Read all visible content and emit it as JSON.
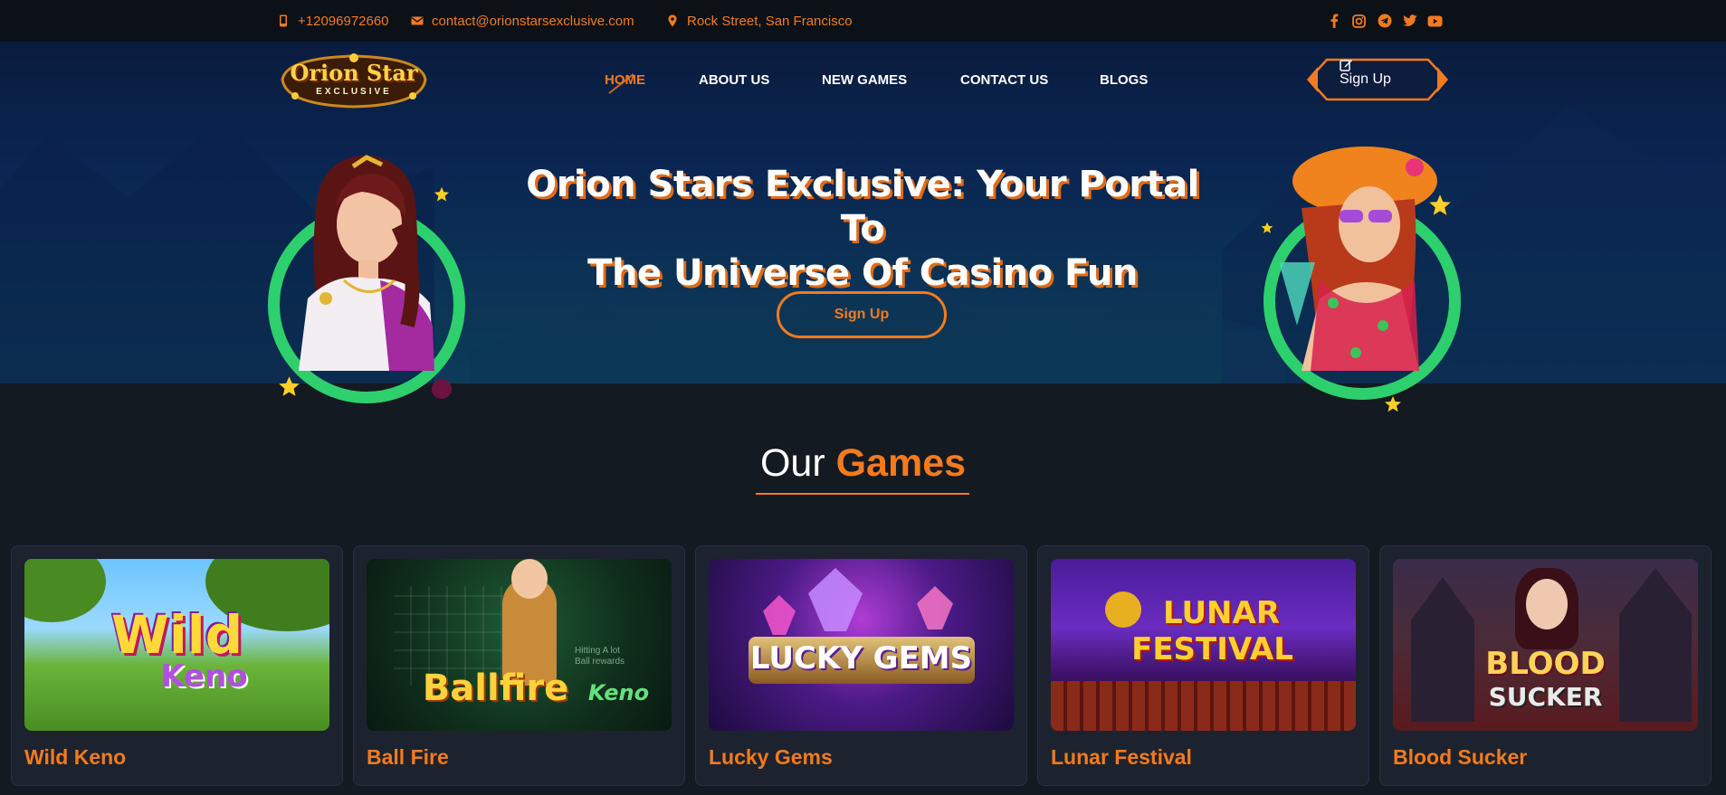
{
  "topbar": {
    "phone": "+12096972660",
    "email": "contact@orionstarsexclusive.com",
    "address": "Rock Street, San Francisco",
    "social_icons": [
      "facebook-icon",
      "instagram-icon",
      "telegram-icon",
      "twitter-icon",
      "youtube-icon"
    ]
  },
  "header": {
    "logo_line1": "Orion Star",
    "logo_line2": "EXCLUSIVE",
    "nav": [
      "HOME",
      "ABOUT US",
      "NEW GAMES",
      "CONTACT US",
      "BLOGS"
    ],
    "active_nav": "HOME",
    "signup_label": "Sign Up"
  },
  "hero": {
    "title_line1": "Orion Stars Exclusive: Your Portal To",
    "title_line2": "The Universe Of Casino Fun",
    "cta_label": "Sign Up"
  },
  "games_section": {
    "title_white": "Our",
    "title_orange": "Games",
    "games": [
      {
        "name": "Wild Keno",
        "art_line1": "Wild",
        "art_line2": "Keno"
      },
      {
        "name": "Ball Fire",
        "art_line1": "Ballfire",
        "art_line2": "Keno",
        "art_note1": "Hitting A lot",
        "art_note2": "Ball rewards"
      },
      {
        "name": "Lucky Gems",
        "art_line1": "LUCKY GEMS",
        "art_line2": ""
      },
      {
        "name": "Lunar Festival",
        "art_line1": "LUNAR",
        "art_line2": "FESTIVAL"
      },
      {
        "name": "Blood Sucker",
        "art_line1": "BLOOD",
        "art_line2": "SUCKER"
      }
    ]
  },
  "colors": {
    "accent": "#f47a1f",
    "ring": "#2dd06c",
    "bg": "#141a22",
    "topbar": "#0c1117"
  }
}
